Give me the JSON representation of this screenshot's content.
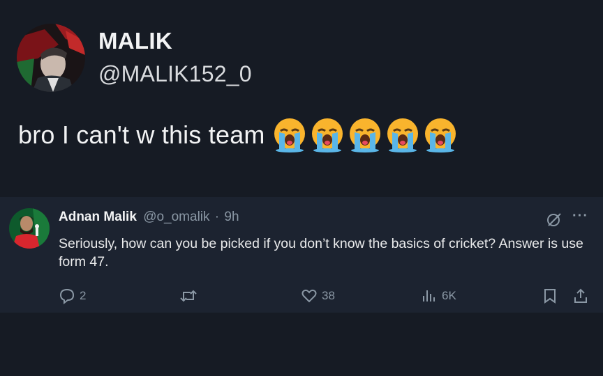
{
  "post": {
    "display_name": "MALIK",
    "handle": "@MALIK152_0",
    "text": "bro I can't w this team",
    "emoji_count": 5,
    "emoji_name": "loudly-crying-face"
  },
  "reply": {
    "display_name": "Adnan Malik",
    "handle": "@o_omalik",
    "separator": "·",
    "time": "9h",
    "text": "Seriously, how can you be picked if you don’t know the basics of cricket? Answer is use form 47.",
    "actions": {
      "replies": "2",
      "reposts": "",
      "likes": "38",
      "views": "6K"
    }
  },
  "colors": {
    "background": "#161b24",
    "reply_background": "#1c2330",
    "muted_text": "#8b98a5",
    "primary_text": "#e7e9ea"
  }
}
